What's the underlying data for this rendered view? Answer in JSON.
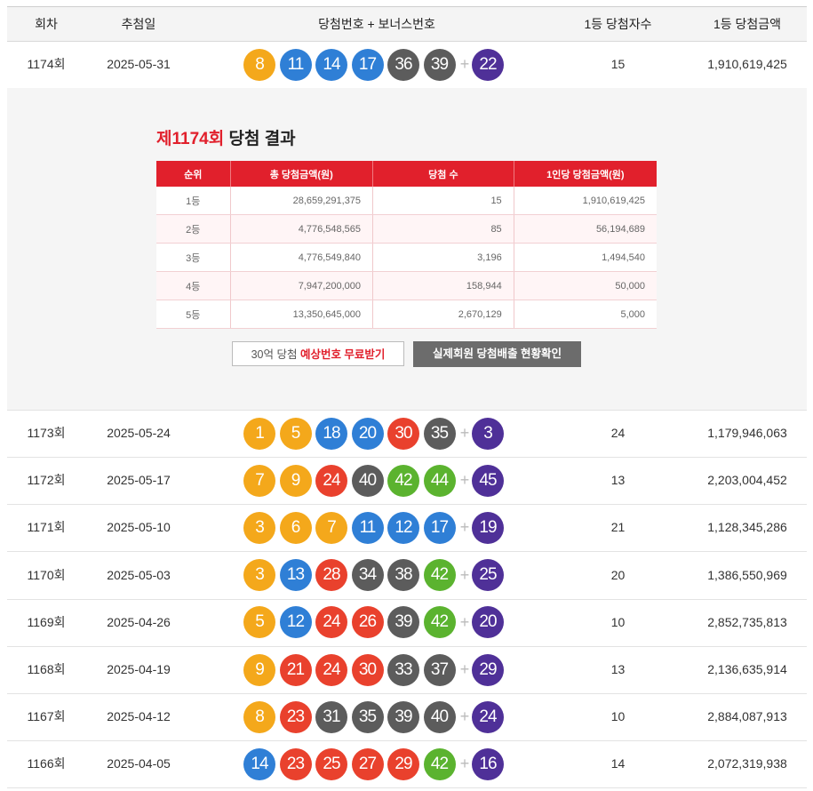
{
  "headers": {
    "round": "회차",
    "date": "추첨일",
    "numbers": "당첨번호 + 보너스번호",
    "winners": "1등 당첨자수",
    "amount": "1등 당첨금액"
  },
  "plus_sign": "+",
  "first": {
    "round": "1174회",
    "date": "2025-05-31",
    "balls": [
      {
        "n": "8",
        "color": "yellow"
      },
      {
        "n": "11",
        "color": "blue"
      },
      {
        "n": "14",
        "color": "blue"
      },
      {
        "n": "17",
        "color": "blue"
      },
      {
        "n": "36",
        "color": "gray"
      },
      {
        "n": "39",
        "color": "gray"
      }
    ],
    "bonus": {
      "n": "22",
      "color": "purple"
    },
    "winners": "15",
    "amount": "1,910,619,425"
  },
  "detail": {
    "title_round": "제1174회",
    "title_rest": " 당첨 결과",
    "columns": [
      "순위",
      "총 당첨금액(원)",
      "당첨 수",
      "1인당 당첨금액(원)"
    ],
    "rows": [
      {
        "rank": "1등",
        "total": "28,659,291,375",
        "count": "15",
        "per": "1,910,619,425"
      },
      {
        "rank": "2등",
        "total": "4,776,548,565",
        "count": "85",
        "per": "56,194,689"
      },
      {
        "rank": "3등",
        "total": "4,776,549,840",
        "count": "3,196",
        "per": "1,494,540"
      },
      {
        "rank": "4등",
        "total": "7,947,200,000",
        "count": "158,944",
        "per": "50,000"
      },
      {
        "rank": "5등",
        "total": "13,350,645,000",
        "count": "2,670,129",
        "per": "5,000"
      }
    ],
    "btn_predict_pre": "30억 당첨 ",
    "btn_predict_red": "예상번호 무료받기",
    "btn_members": "실제회원 당첨배출 현황확인"
  },
  "rows": [
    {
      "round": "1173회",
      "date": "2025-05-24",
      "balls": [
        {
          "n": "1",
          "color": "yellow"
        },
        {
          "n": "5",
          "color": "yellow"
        },
        {
          "n": "18",
          "color": "blue"
        },
        {
          "n": "20",
          "color": "blue"
        },
        {
          "n": "30",
          "color": "red"
        },
        {
          "n": "35",
          "color": "gray"
        }
      ],
      "bonus": {
        "n": "3",
        "color": "purple"
      },
      "winners": "24",
      "amount": "1,179,946,063"
    },
    {
      "round": "1172회",
      "date": "2025-05-17",
      "balls": [
        {
          "n": "7",
          "color": "yellow"
        },
        {
          "n": "9",
          "color": "yellow"
        },
        {
          "n": "24",
          "color": "red"
        },
        {
          "n": "40",
          "color": "gray"
        },
        {
          "n": "42",
          "color": "green"
        },
        {
          "n": "44",
          "color": "green"
        }
      ],
      "bonus": {
        "n": "45",
        "color": "purple"
      },
      "winners": "13",
      "amount": "2,203,004,452"
    },
    {
      "round": "1171회",
      "date": "2025-05-10",
      "balls": [
        {
          "n": "3",
          "color": "yellow"
        },
        {
          "n": "6",
          "color": "yellow"
        },
        {
          "n": "7",
          "color": "yellow"
        },
        {
          "n": "11",
          "color": "blue"
        },
        {
          "n": "12",
          "color": "blue"
        },
        {
          "n": "17",
          "color": "blue"
        }
      ],
      "bonus": {
        "n": "19",
        "color": "purple"
      },
      "winners": "21",
      "amount": "1,128,345,286"
    },
    {
      "round": "1170회",
      "date": "2025-05-03",
      "balls": [
        {
          "n": "3",
          "color": "yellow"
        },
        {
          "n": "13",
          "color": "blue"
        },
        {
          "n": "28",
          "color": "red"
        },
        {
          "n": "34",
          "color": "gray"
        },
        {
          "n": "38",
          "color": "gray"
        },
        {
          "n": "42",
          "color": "green"
        }
      ],
      "bonus": {
        "n": "25",
        "color": "purple"
      },
      "winners": "20",
      "amount": "1,386,550,969"
    },
    {
      "round": "1169회",
      "date": "2025-04-26",
      "balls": [
        {
          "n": "5",
          "color": "yellow"
        },
        {
          "n": "12",
          "color": "blue"
        },
        {
          "n": "24",
          "color": "red"
        },
        {
          "n": "26",
          "color": "red"
        },
        {
          "n": "39",
          "color": "gray"
        },
        {
          "n": "42",
          "color": "green"
        }
      ],
      "bonus": {
        "n": "20",
        "color": "purple"
      },
      "winners": "10",
      "amount": "2,852,735,813"
    },
    {
      "round": "1168회",
      "date": "2025-04-19",
      "balls": [
        {
          "n": "9",
          "color": "yellow"
        },
        {
          "n": "21",
          "color": "red"
        },
        {
          "n": "24",
          "color": "red"
        },
        {
          "n": "30",
          "color": "red"
        },
        {
          "n": "33",
          "color": "gray"
        },
        {
          "n": "37",
          "color": "gray"
        }
      ],
      "bonus": {
        "n": "29",
        "color": "purple"
      },
      "winners": "13",
      "amount": "2,136,635,914"
    },
    {
      "round": "1167회",
      "date": "2025-04-12",
      "balls": [
        {
          "n": "8",
          "color": "yellow"
        },
        {
          "n": "23",
          "color": "red"
        },
        {
          "n": "31",
          "color": "gray"
        },
        {
          "n": "35",
          "color": "gray"
        },
        {
          "n": "39",
          "color": "gray"
        },
        {
          "n": "40",
          "color": "gray"
        }
      ],
      "bonus": {
        "n": "24",
        "color": "purple"
      },
      "winners": "10",
      "amount": "2,884,087,913"
    },
    {
      "round": "1166회",
      "date": "2025-04-05",
      "balls": [
        {
          "n": "14",
          "color": "blue"
        },
        {
          "n": "23",
          "color": "red"
        },
        {
          "n": "25",
          "color": "red"
        },
        {
          "n": "27",
          "color": "red"
        },
        {
          "n": "29",
          "color": "red"
        },
        {
          "n": "42",
          "color": "green"
        }
      ],
      "bonus": {
        "n": "16",
        "color": "purple"
      },
      "winners": "14",
      "amount": "2,072,319,938"
    }
  ],
  "colors": {
    "yellow": "#f4a81b",
    "blue": "#2f7fd6",
    "red": "#e9412d",
    "gray": "#5c5c5c",
    "green": "#5bb32f",
    "purple": "#4f3098",
    "accent": "#e1202c"
  }
}
